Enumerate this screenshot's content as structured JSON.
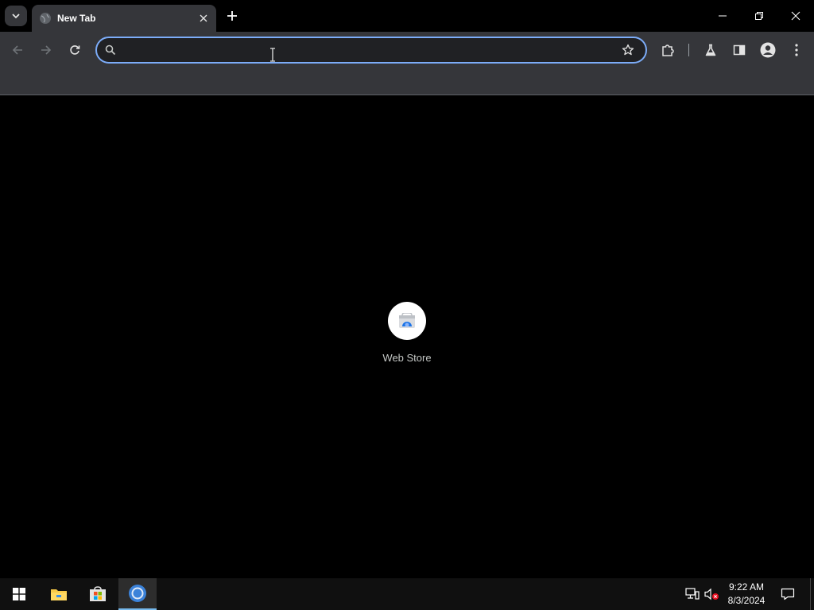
{
  "browser": {
    "tab": {
      "title": "New Tab"
    },
    "omnibox": {
      "value": "",
      "placeholder": ""
    }
  },
  "new_tab_page": {
    "shortcuts": [
      {
        "label": "Web Store",
        "icon": "web-store-icon"
      }
    ]
  },
  "taskbar": {
    "apps": [
      {
        "name": "file-explorer-icon"
      },
      {
        "name": "microsoft-store-icon"
      },
      {
        "name": "chrome-icon",
        "active": true
      }
    ],
    "clock": {
      "time": "9:22 AM",
      "date": "8/3/2024"
    }
  },
  "colors": {
    "accent": "#7cacf8",
    "toolbar": "#35363a",
    "page_bg": "#000000"
  }
}
